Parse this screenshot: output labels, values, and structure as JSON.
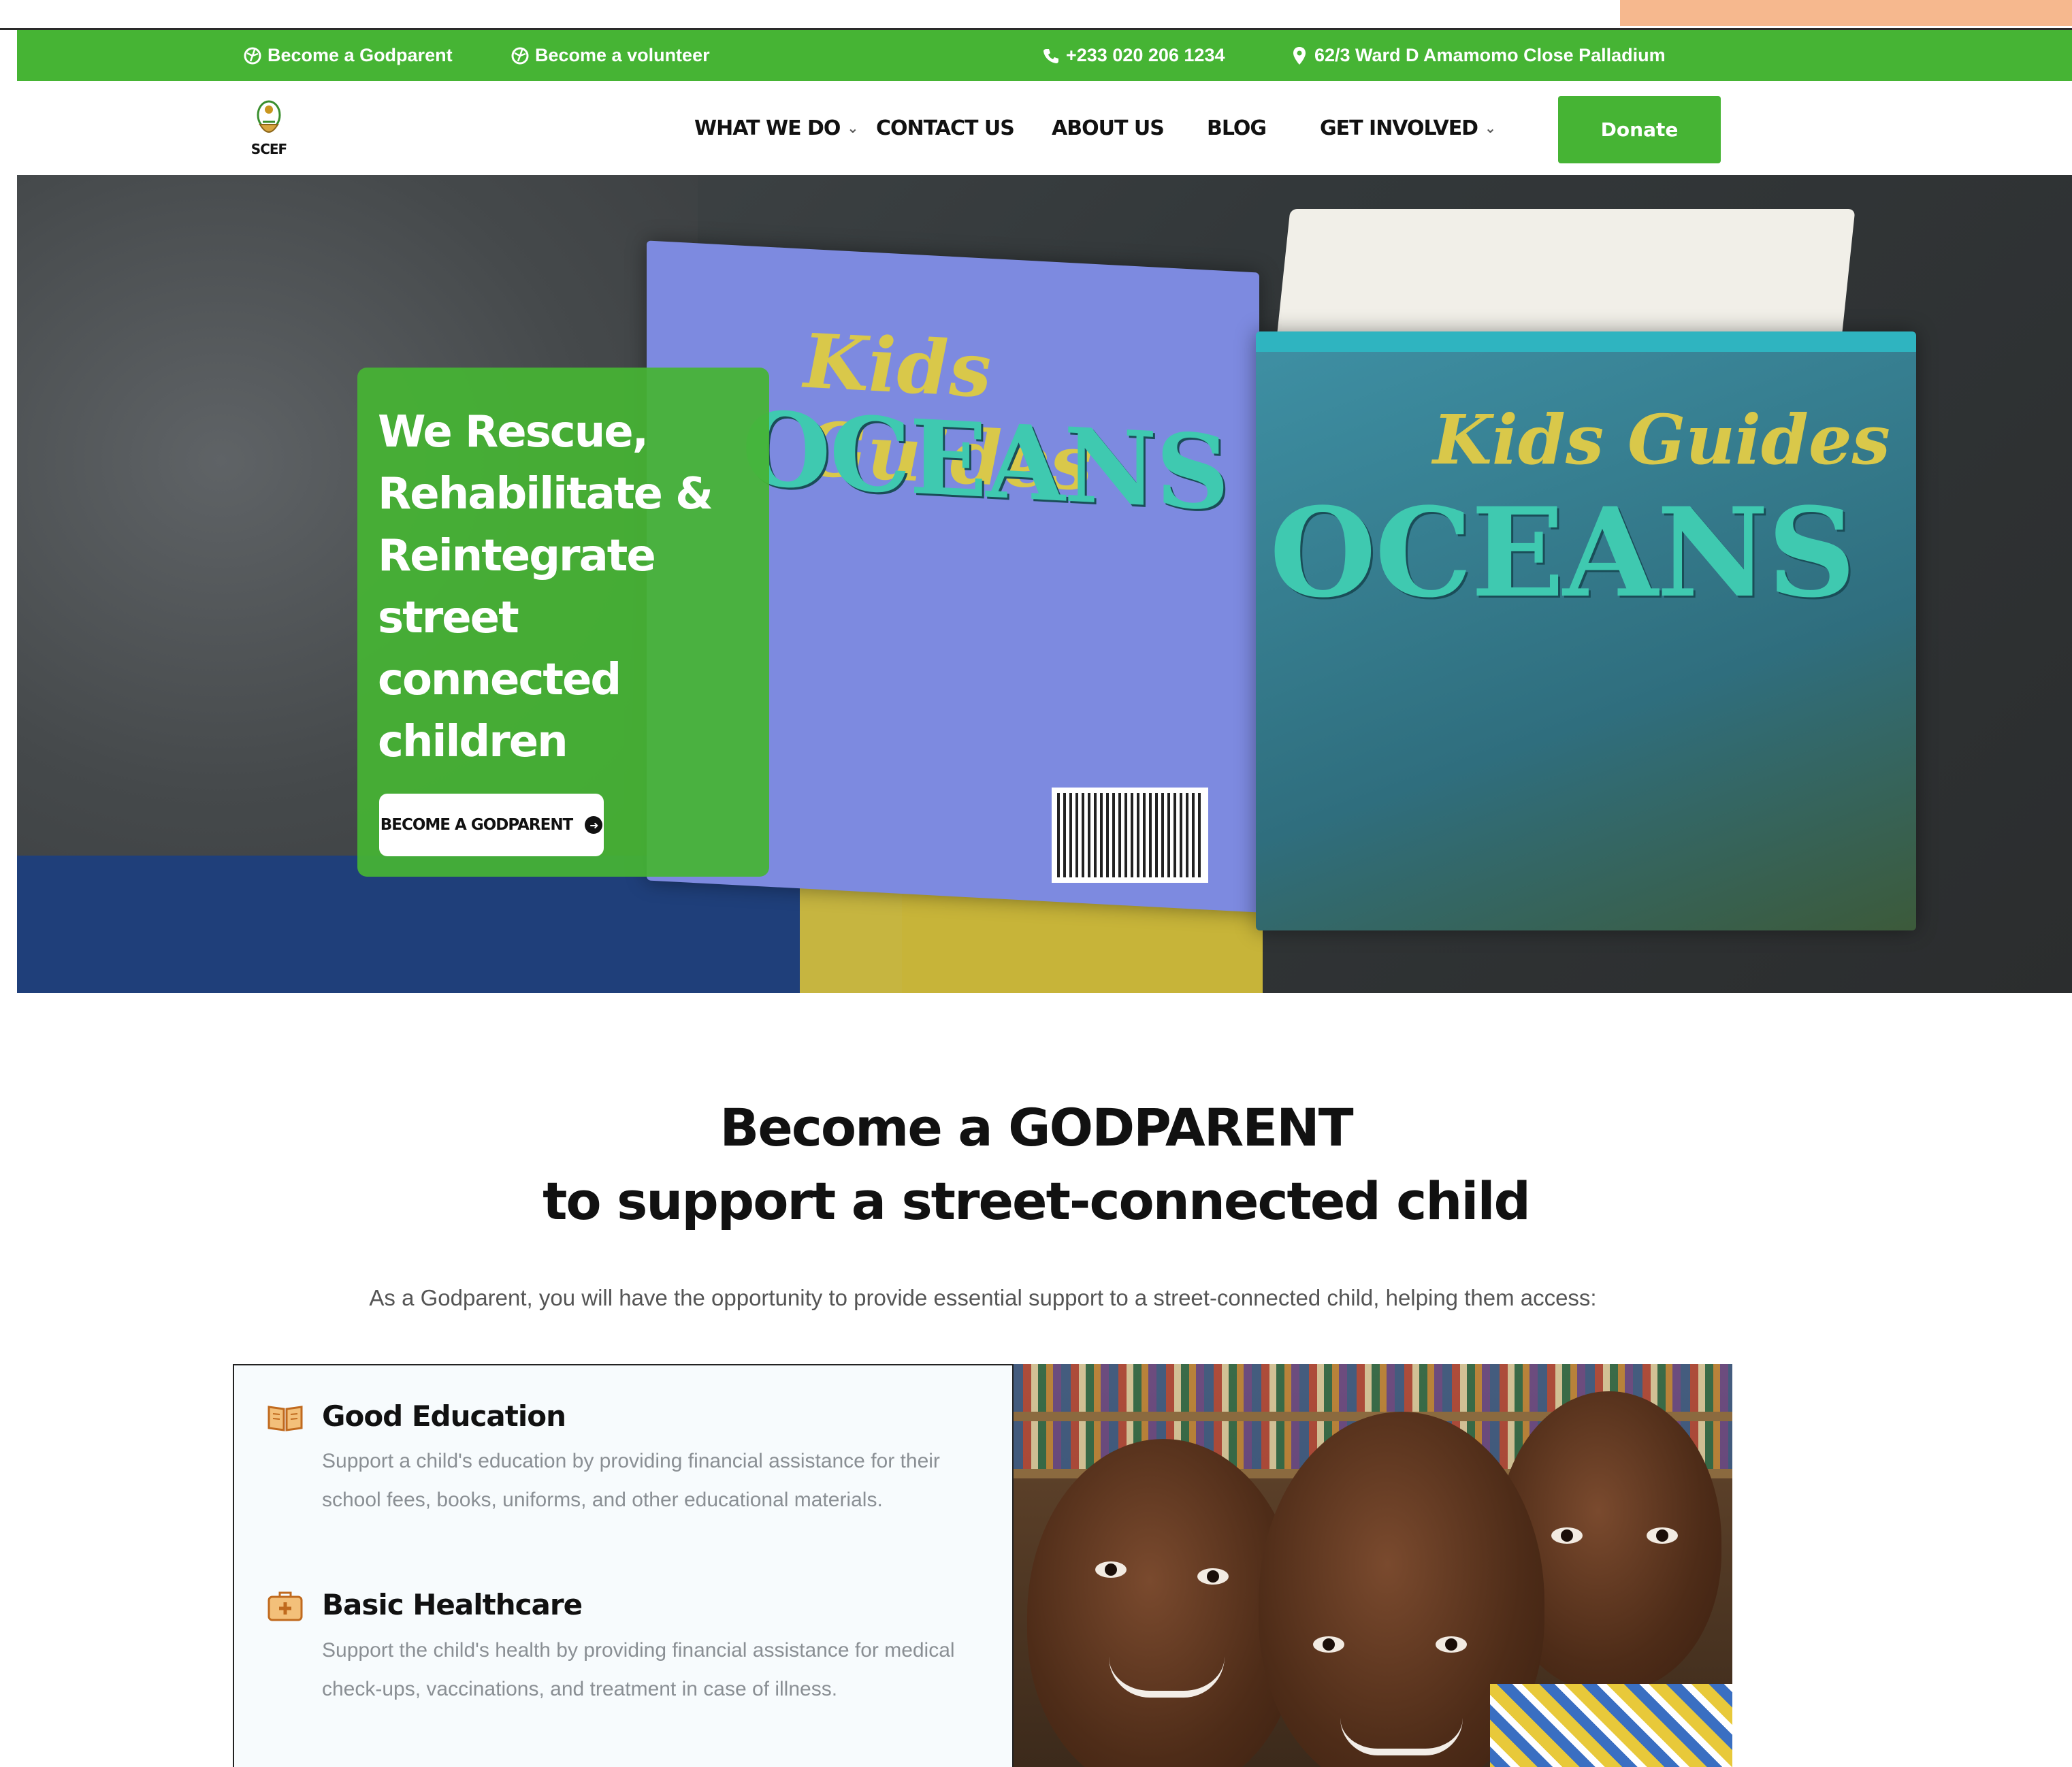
{
  "topbar": {
    "godparent_link": "Become a Godparent",
    "volunteer_link": "Become a volunteer",
    "phone": "+233 020 206 1234",
    "address": "62/3 Ward D Amamomo Close Palladium"
  },
  "nav": {
    "logo_text": "SCEF",
    "items": [
      "WHAT WE DO",
      "CONTACT US",
      "ABOUT US",
      "BLOG",
      "GET INVOLVED"
    ],
    "donate_label": "Donate"
  },
  "hero": {
    "title": "We Rescue, Rehabilitate & Reintegrate street connected children",
    "cta_label": "BECOME A GODPARENT",
    "book_series": "Kids Guides",
    "book_title": "OCEANS"
  },
  "godparent": {
    "heading_line1": "Become a GODPARENT",
    "heading_line2": "to support a street-connected child",
    "lead": "As a Godparent, you will have the opportunity to provide essential support to a street-connected child, helping them access:",
    "benefits": [
      {
        "title": "Good Education",
        "text": "Support a child's education by providing financial assistance for their school fees, books, uniforms, and other educational materials.",
        "icon": "open-book-icon"
      },
      {
        "title": "Basic Healthcare",
        "text": "Support the child's health by providing financial assistance for medical check-ups, vaccinations, and treatment in case of illness.",
        "icon": "first-aid-kit-icon"
      }
    ]
  },
  "colors": {
    "brand_green": "#46b434",
    "icon_orange": "#e08a2c"
  }
}
